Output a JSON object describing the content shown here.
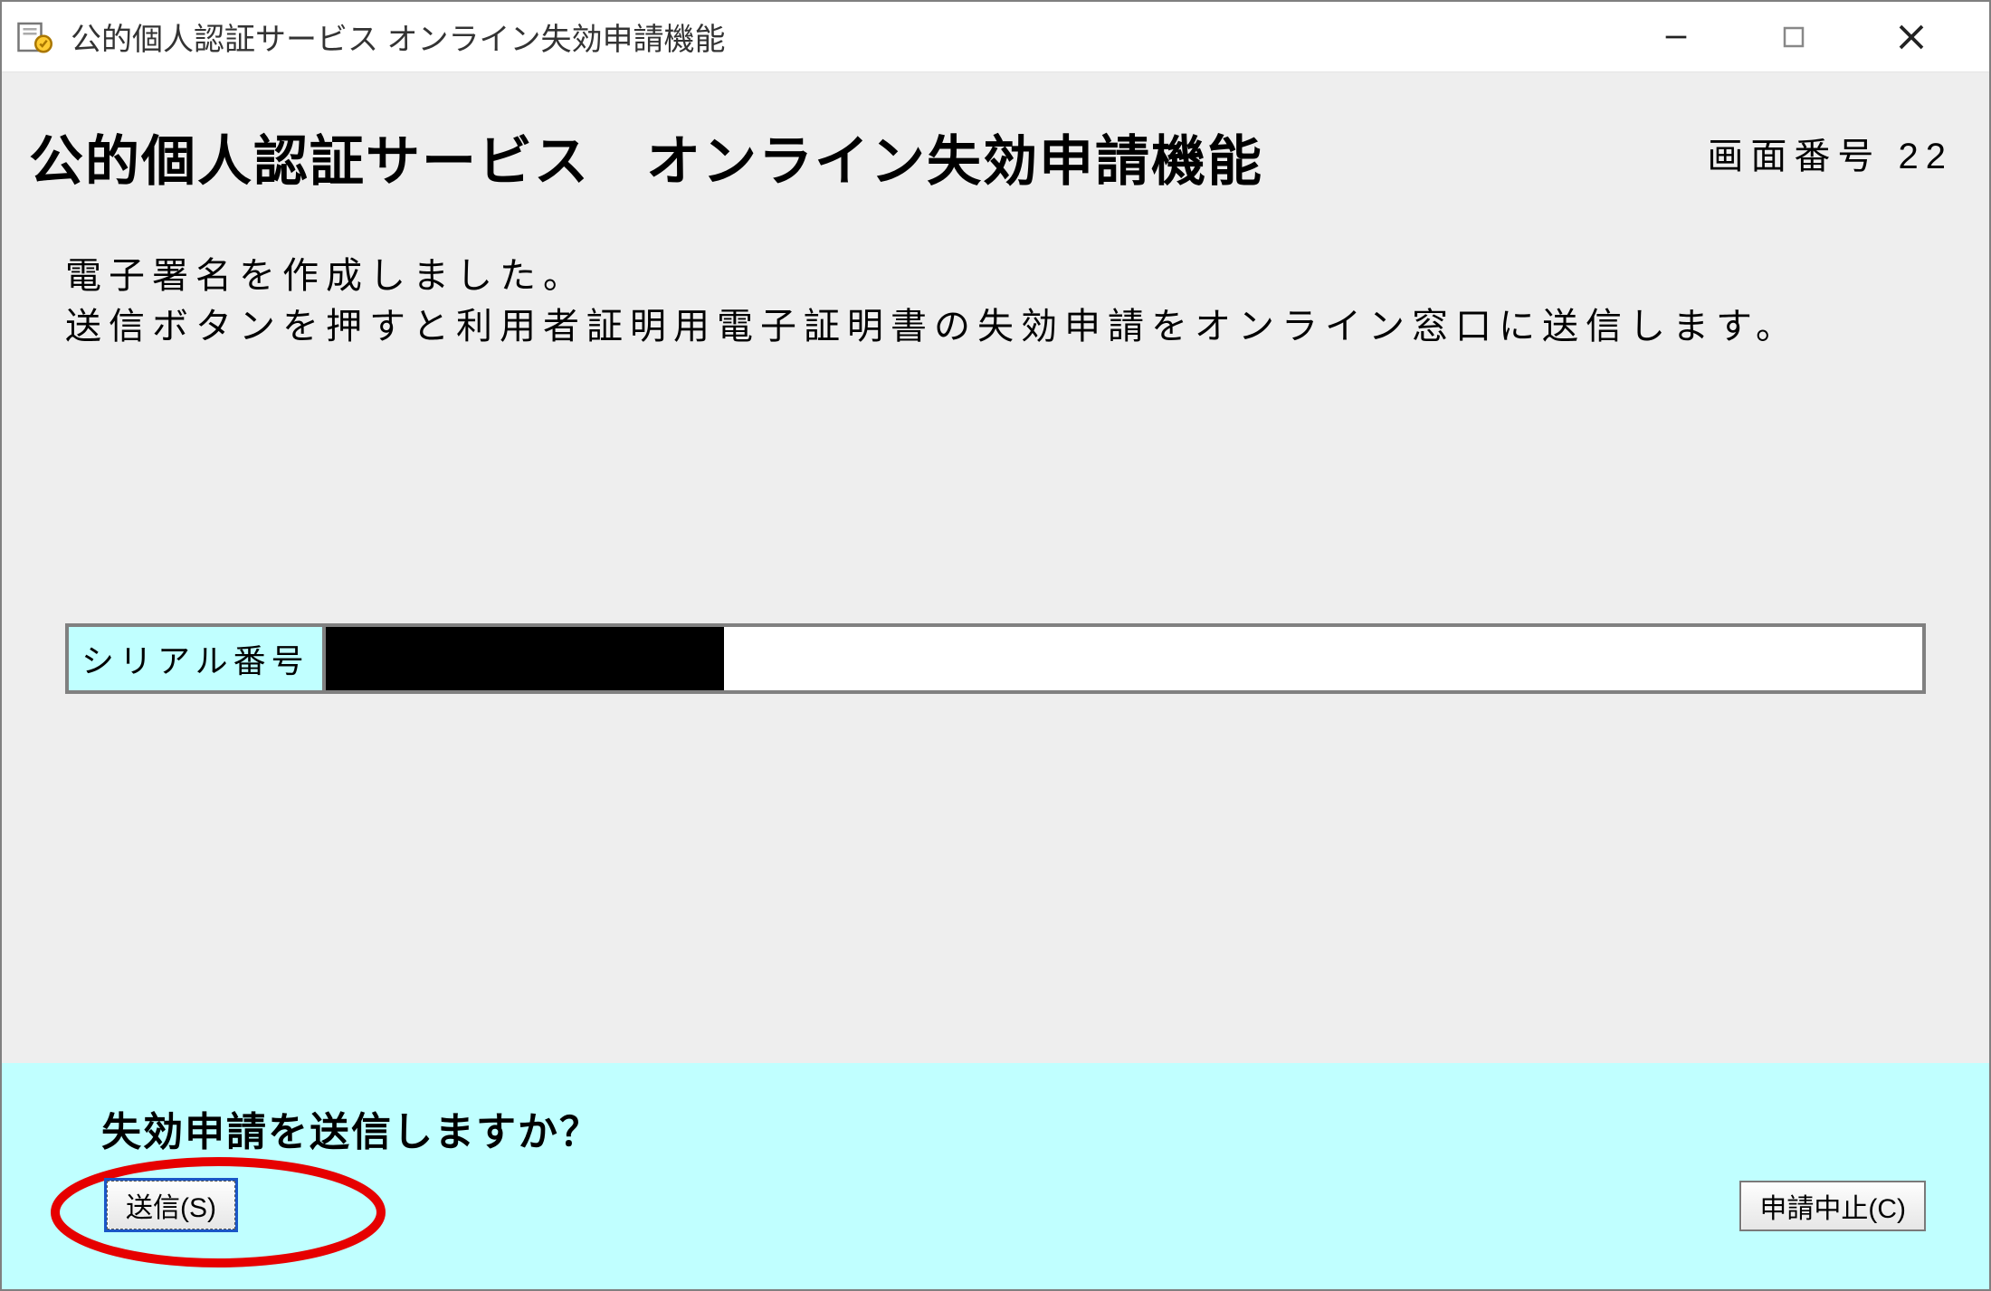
{
  "window": {
    "title": "公的個人認証サービス オンライン失効申請機能"
  },
  "header": {
    "page_title": "公的個人認証サービス　オンライン失効申請機能",
    "screen_number": "画面番号 22"
  },
  "message": "電子署名を作成しました。\n送信ボタンを押すと利用者証明用電子証明書の失効申請をオンライン窓口に送信します。",
  "serial": {
    "label": "シリアル番号"
  },
  "footer": {
    "prompt": "失効申請を送信しますか？",
    "submit_label": "送信(S)",
    "cancel_label": "申請中止(C)"
  }
}
